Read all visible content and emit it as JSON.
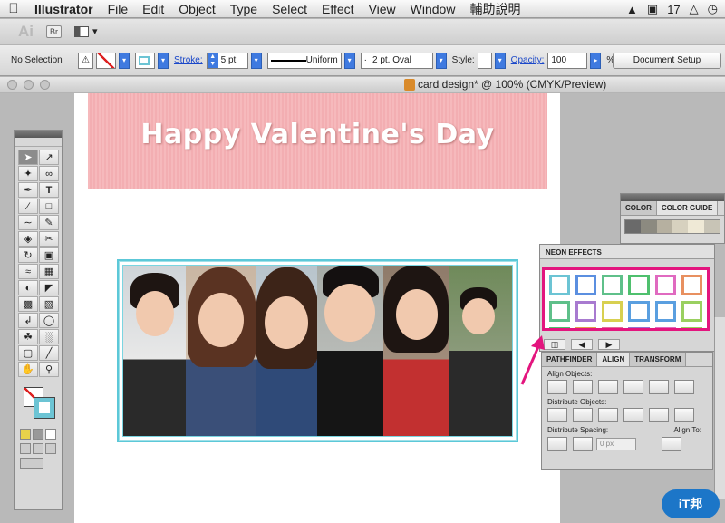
{
  "menubar": {
    "app_name": "Illustrator",
    "items": [
      "File",
      "Edit",
      "Object",
      "Type",
      "Select",
      "Effect",
      "View",
      "Window",
      "輔助說明"
    ],
    "status_count": "17"
  },
  "appbar": {
    "logo": "Ai",
    "bridge_label": "Br"
  },
  "controlbar": {
    "selection_status": "No Selection",
    "stroke_label": "Stroke:",
    "stroke_weight": "5 pt",
    "stroke_profile": "Uniform",
    "brush_label": "2 pt. Oval",
    "style_label": "Style:",
    "opacity_label": "Opacity:",
    "opacity_value": "100",
    "opacity_unit": "%",
    "doc_setup_label": "Document Setup"
  },
  "document": {
    "title": "card design* @ 100% (CMYK/Preview)"
  },
  "banner": {
    "text": "Happy Valentine's Day"
  },
  "color_panel": {
    "tabs": [
      "COLOR",
      "COLOR GUIDE"
    ],
    "guide_colors": [
      "#6a6a6a",
      "#8c8a80",
      "#b6b0a0",
      "#d7d1bf",
      "#efe9d6",
      "#c8c4b6"
    ]
  },
  "neon_panel": {
    "title": "NEON EFFECTS",
    "swatch_colors": [
      "#6cc4d4",
      "#5b8fe0",
      "#5fc08a",
      "#4fc06e",
      "#e06ac0",
      "#e89060",
      "#5fc08a",
      "#a87ad0",
      "#d8d050",
      "#5a9fe0",
      "#5a9fe0",
      "#9ad060",
      "#4fc06e",
      "#e0a050",
      "#e06a9a",
      "#9a70d0",
      "#e06ac0",
      "#9ad060"
    ]
  },
  "align_panel": {
    "tabs": [
      "PATHFINDER",
      "ALIGN",
      "TRANSFORM"
    ],
    "align_objects_label": "Align Objects:",
    "distribute_objects_label": "Distribute Objects:",
    "distribute_spacing_label": "Distribute Spacing:",
    "align_to_label": "Align To:",
    "spacing_value": "0 px"
  },
  "watermark": {
    "text": "iT邦"
  },
  "colors": {
    "banner_pink": "#f6b9bc",
    "frame_cyan": "#5cc8d8",
    "highlight_magenta": "#e3157e"
  }
}
